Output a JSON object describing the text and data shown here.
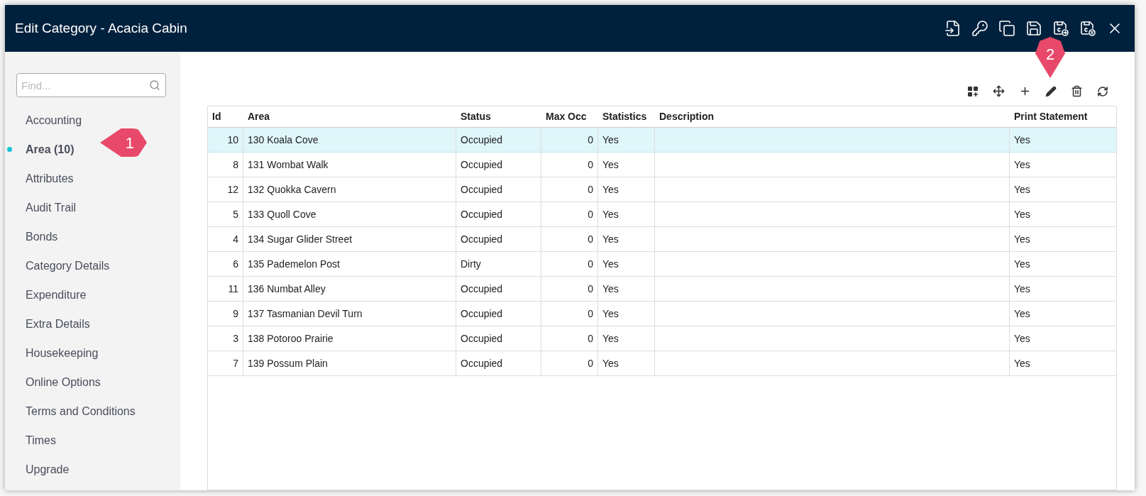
{
  "window": {
    "title": "Edit Category - Acacia Cabin"
  },
  "sidebar": {
    "search": {
      "placeholder": "Find..."
    },
    "items": [
      {
        "label": "Accounting",
        "selected": false
      },
      {
        "label": "Area (10)",
        "selected": true
      },
      {
        "label": "Attributes",
        "selected": false
      },
      {
        "label": "Audit Trail",
        "selected": false
      },
      {
        "label": "Bonds",
        "selected": false
      },
      {
        "label": "Category Details",
        "selected": false
      },
      {
        "label": "Expenditure",
        "selected": false
      },
      {
        "label": "Extra Details",
        "selected": false
      },
      {
        "label": "Housekeeping",
        "selected": false
      },
      {
        "label": "Online Options",
        "selected": false
      },
      {
        "label": "Terms and Conditions",
        "selected": false
      },
      {
        "label": "Times",
        "selected": false
      },
      {
        "label": "Upgrade",
        "selected": false
      }
    ]
  },
  "annotations": [
    {
      "label": "1",
      "kind": "left"
    },
    {
      "label": "2",
      "kind": "down"
    }
  ],
  "table": {
    "columns": [
      "Id",
      "Area",
      "Status",
      "Max Occ",
      "Statistics",
      "Description",
      "Print Statement"
    ],
    "rows": [
      {
        "cells": [
          "10",
          "130 Koala Cove",
          "Occupied",
          "0",
          "Yes",
          "",
          "Yes"
        ],
        "selected": true
      },
      {
        "cells": [
          "8",
          "131 Wombat Walk",
          "Occupied",
          "0",
          "Yes",
          "",
          "Yes"
        ],
        "selected": false
      },
      {
        "cells": [
          "12",
          "132 Quokka Cavern",
          "Occupied",
          "0",
          "Yes",
          "",
          "Yes"
        ],
        "selected": false
      },
      {
        "cells": [
          "5",
          "133 Quoll Cove",
          "Occupied",
          "0",
          "Yes",
          "",
          "Yes"
        ],
        "selected": false
      },
      {
        "cells": [
          "4",
          "134 Sugar Glider Street",
          "Occupied",
          "0",
          "Yes",
          "",
          "Yes"
        ],
        "selected": false
      },
      {
        "cells": [
          "6",
          "135 Pademelon Post",
          "Dirty",
          "0",
          "Yes",
          "",
          "Yes"
        ],
        "selected": false
      },
      {
        "cells": [
          "11",
          "136 Numbat Alley",
          "Occupied",
          "0",
          "Yes",
          "",
          "Yes"
        ],
        "selected": false
      },
      {
        "cells": [
          "9",
          "137 Tasmanian Devil Turn",
          "Occupied",
          "0",
          "Yes",
          "",
          "Yes"
        ],
        "selected": false
      },
      {
        "cells": [
          "3",
          "138 Potoroo Prairie",
          "Occupied",
          "0",
          "Yes",
          "",
          "Yes"
        ],
        "selected": false
      },
      {
        "cells": [
          "7",
          "139 Possum Plain",
          "Occupied",
          "0",
          "Yes",
          "",
          "Yes"
        ],
        "selected": false
      }
    ]
  }
}
